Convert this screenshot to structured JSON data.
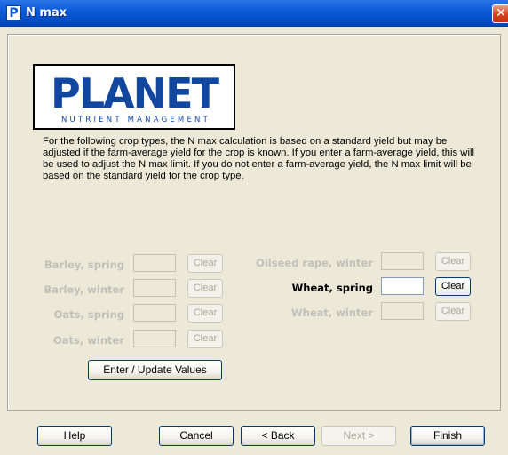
{
  "window": {
    "title": "N max",
    "icon_letter": "P",
    "close_glyph": "✕"
  },
  "logo": {
    "word": "PLANET",
    "subtitle": "NUTRIENT MANAGEMENT",
    "color": "#11479f"
  },
  "description": "For the following crop types, the N max calculation is based on a standard yield but may be adjusted if the farm-average yield for the crop is known. If you enter a farm-average yield, this will be used to adjust the N max limit. If you do not enter a farm-average yield, the N max limit will be based on the standard yield for the crop type.",
  "crops_left": [
    {
      "label": "Barley, spring",
      "value": "",
      "clear_label": "Clear",
      "enabled": false
    },
    {
      "label": "Barley, winter",
      "value": "",
      "clear_label": "Clear",
      "enabled": false
    },
    {
      "label": "Oats, spring",
      "value": "",
      "clear_label": "Clear",
      "enabled": false
    },
    {
      "label": "Oats, winter",
      "value": "",
      "clear_label": "Clear",
      "enabled": false
    }
  ],
  "crops_right": [
    {
      "label": "Oilseed rape, winter",
      "value": "",
      "clear_label": "Clear",
      "enabled": false
    },
    {
      "label": "Wheat, spring",
      "value": "",
      "clear_label": "Clear",
      "enabled": true
    },
    {
      "label": "Wheat, winter",
      "value": "",
      "clear_label": "Clear",
      "enabled": false
    }
  ],
  "enter_update_label": "Enter / Update Values",
  "footer": {
    "help": "Help",
    "cancel": "Cancel",
    "back": "< Back",
    "next": "Next >",
    "finish": "Finish"
  },
  "colors": {
    "titlebar": "#0a58d8",
    "dialog_bg": "#ece9d8",
    "disabled_text": "#c0bfb8"
  }
}
